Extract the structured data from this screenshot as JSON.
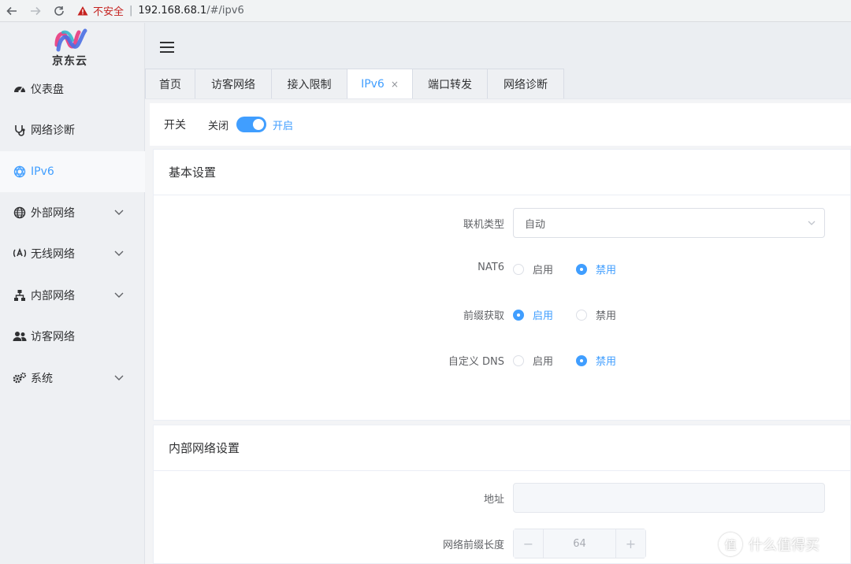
{
  "browser": {
    "back_icon": "back-arrow-icon",
    "forward_icon": "forward-arrow-icon",
    "reload_icon": "reload-icon",
    "security_label": "不安全",
    "separator": "|",
    "url_host": "192.168.68.1",
    "url_path": "/#/ipv6"
  },
  "brand": {
    "logo_text": "京东云"
  },
  "sidebar": {
    "items": [
      {
        "label": "仪表盘",
        "icon": "dashboard-icon",
        "expandable": false,
        "active": false
      },
      {
        "label": "网络诊断",
        "icon": "stethoscope-icon",
        "expandable": false,
        "active": false
      },
      {
        "label": "IPv6",
        "icon": "ipv6-icon",
        "expandable": false,
        "active": true
      },
      {
        "label": "外部网络",
        "icon": "globe-icon",
        "expandable": true,
        "active": false
      },
      {
        "label": "无线网络",
        "icon": "wireless-icon",
        "expandable": true,
        "active": false
      },
      {
        "label": "内部网络",
        "icon": "lan-icon",
        "expandable": true,
        "active": false
      },
      {
        "label": "访客网络",
        "icon": "users-icon",
        "expandable": false,
        "active": false
      },
      {
        "label": "系统",
        "icon": "gears-icon",
        "expandable": true,
        "active": false
      }
    ]
  },
  "tabs": [
    {
      "label": "首页",
      "active": false
    },
    {
      "label": "访客网络",
      "active": false
    },
    {
      "label": "接入限制",
      "active": false
    },
    {
      "label": "IPv6",
      "active": true,
      "close": "×"
    },
    {
      "label": "端口转发",
      "active": false
    },
    {
      "label": "网络诊断",
      "active": false
    }
  ],
  "switch_row": {
    "title": "开关",
    "off_label": "关闭",
    "on_label": "开启",
    "enabled": true
  },
  "basic": {
    "title": "基本设置",
    "conn_type_label": "联机类型",
    "conn_type_value": "自动",
    "nat6_label": "NAT6",
    "prefix_label": "前缀获取",
    "dns_label": "自定义 DNS",
    "enable_label": "启用",
    "disable_label": "禁用",
    "nat6_value": "禁用",
    "prefix_value": "启用",
    "dns_value": "禁用"
  },
  "lan": {
    "title": "内部网络设置",
    "address_label": "地址",
    "address_value": "",
    "prefix_len_label": "网络前缀长度",
    "prefix_len_value": "64",
    "minus": "−",
    "plus": "+"
  },
  "watermark": {
    "logo": "值",
    "text": "什么值得买"
  },
  "colors": {
    "accent": "#409eff",
    "sidebar_bg": "#eef0f3",
    "insecure": "#c5221f"
  }
}
